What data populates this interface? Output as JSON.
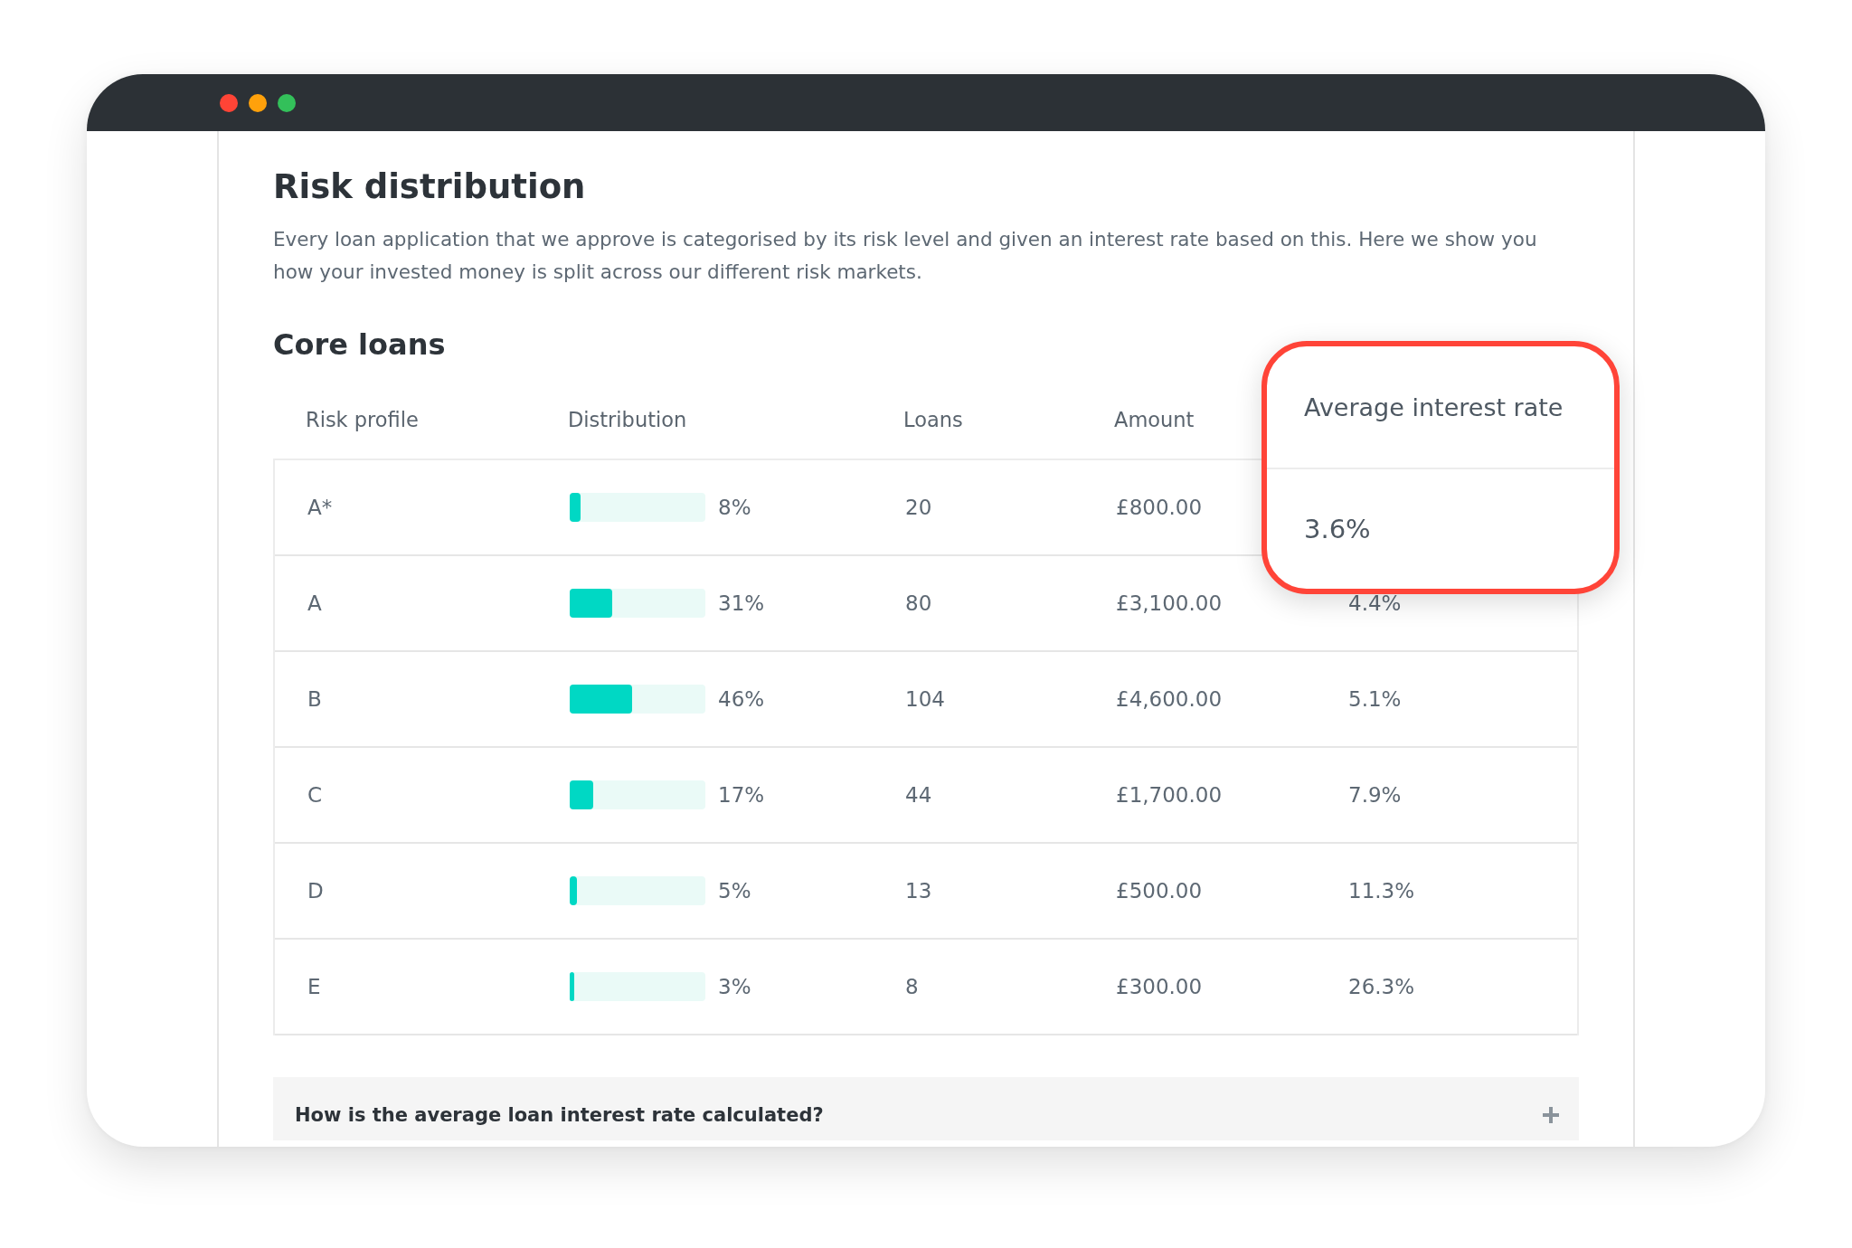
{
  "title": "Risk distribution",
  "intro": "Every loan application that we approve is categorised by its risk level and given an interest rate based on this. Here we show you how your invested money is split across our different risk markets.",
  "section_title": "Core loans",
  "table": {
    "columns": [
      "Risk profile",
      "Distribution",
      "Loans",
      "Amount"
    ],
    "rows": [
      {
        "profile": "A*",
        "level": 0.08,
        "share": "8%",
        "loans": "20",
        "amount": "£800.00"
      },
      {
        "profile": "A",
        "level": 0.31,
        "share": "31%",
        "loans": "80",
        "amount": "£3,100.00",
        "rate": "4.4%"
      },
      {
        "profile": "B",
        "level": 0.46,
        "share": "46%",
        "loans": "104",
        "amount": "£4,600.00",
        "rate": "5.1%"
      },
      {
        "profile": "C",
        "level": 0.17,
        "share": "17%",
        "loans": "44",
        "amount": "£1,700.00",
        "rate": "7.9%"
      },
      {
        "profile": "D",
        "level": 0.05,
        "share": "5%",
        "loans": "13",
        "amount": "£500.00",
        "rate": "11.3%"
      },
      {
        "profile": "E",
        "level": 0.03,
        "share": "3%",
        "loans": "8",
        "amount": "£300.00",
        "rate": "26.3%"
      }
    ]
  },
  "highlight": {
    "heading": "Average interest rate",
    "value": "3.6%"
  },
  "faq": {
    "question": "How is the average loan interest rate calculated?",
    "expanded": false
  }
}
